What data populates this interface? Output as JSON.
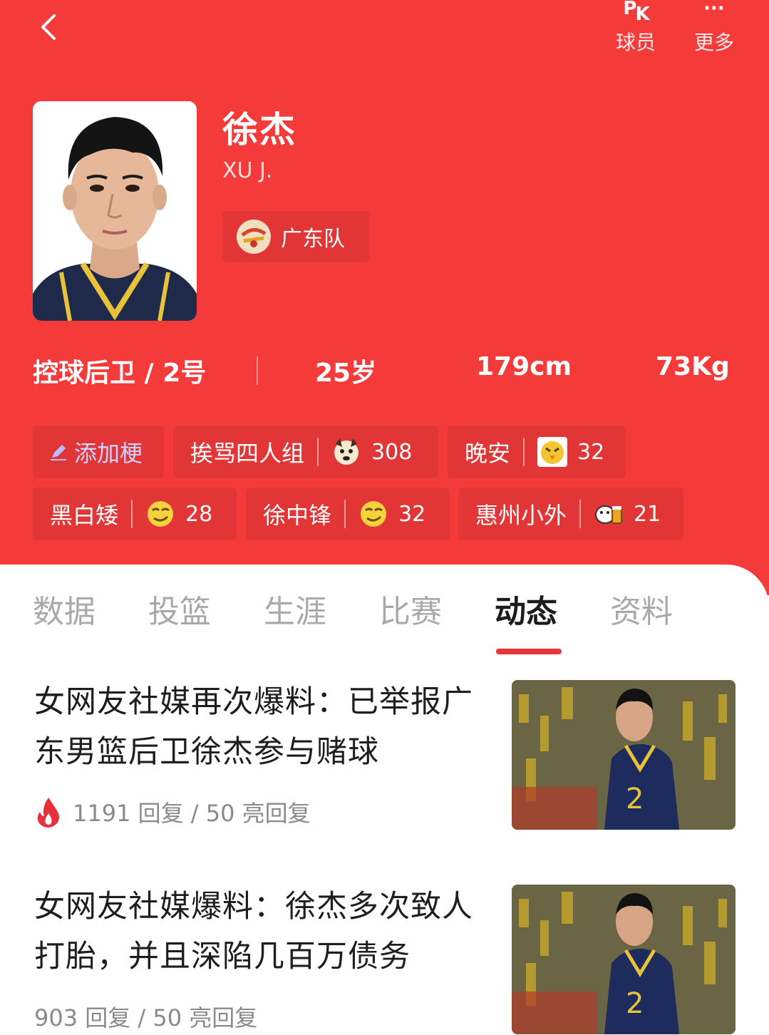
{
  "header": {
    "back_icon": "chevron-left-icon",
    "actions": [
      {
        "icon": "pk-icon",
        "label": "球员"
      },
      {
        "icon": "more-dots-icon",
        "label": "更多"
      }
    ],
    "pk_glyph": [
      "P",
      "K"
    ],
    "more_glyph": "···"
  },
  "player": {
    "name": "徐杰",
    "name_en": "XU J.",
    "team": "广东队",
    "position": "控球后卫 / 2号",
    "age": "25岁",
    "height": "179cm",
    "weight": "73Kg"
  },
  "tags": {
    "add_label": "添加梗",
    "items": [
      {
        "label": "挨骂四人组",
        "emoji": "dog-face-icon",
        "count": "308"
      },
      {
        "label": "晚安",
        "emoji": "chick-face-icon",
        "count": "32"
      },
      {
        "label": "黑白矮",
        "emoji": "smirk-face-icon",
        "count": "28"
      },
      {
        "label": "徐中锋",
        "emoji": "smirk-face-icon",
        "count": "32"
      },
      {
        "label": "惠州小外",
        "emoji": "cow-beer-icon",
        "count": "21"
      }
    ]
  },
  "tabs": [
    {
      "label": "数据",
      "active": false
    },
    {
      "label": "投篮",
      "active": false
    },
    {
      "label": "生涯",
      "active": false
    },
    {
      "label": "比赛",
      "active": false
    },
    {
      "label": "动态",
      "active": true
    },
    {
      "label": "资料",
      "active": false
    }
  ],
  "news": [
    {
      "title_line1": "女网友社媒再次爆料：已举报广",
      "title_line2": "东男篮后卫徐杰参与赌球",
      "meta": "1191 回复 / 50 亮回复",
      "hot": true
    },
    {
      "title_line1": "女网友社媒爆料：徐杰多次致人",
      "title_line2": "打胎，并且深陷几百万债务",
      "meta": "903 回复 / 50 亮回复",
      "hot": false
    }
  ],
  "colors": {
    "header_bg": "#f53a3a",
    "chip_bg": "#e23535",
    "tab_active_underline": "#e8343a"
  }
}
